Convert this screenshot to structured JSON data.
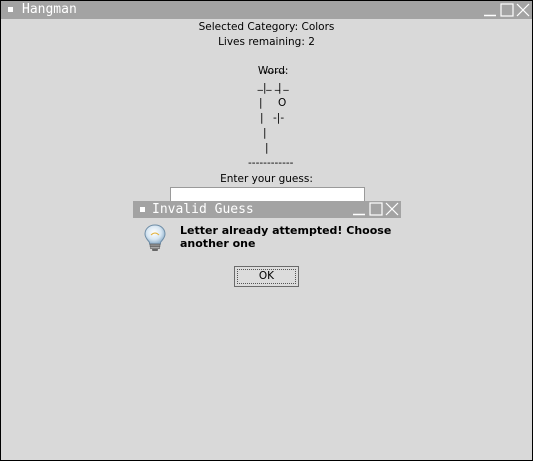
{
  "window": {
    "title": "Hangman",
    "controls": [
      "minimize-icon",
      "maximize-icon",
      "close-icon"
    ]
  },
  "game": {
    "category_text": "Selected Category: Colors",
    "lives_text": "Lives remaining: 2",
    "word_label": "Word:",
    "word_blanks": "_ _ _ _",
    "gallows": {
      "top_bar": "------",
      "row1_left": "|",
      "row1_right": "|",
      "row2_left": "|",
      "row2_right": "O",
      "row3_left": "|",
      "row3_right": "-|-",
      "row4": "|",
      "row5": "|",
      "base": "------------"
    },
    "guess_prompt": "Enter your guess:",
    "guess_value": ""
  },
  "dialog": {
    "title": "Invalid Guess",
    "message": "Letter already attempted! Choose another one",
    "icon": "lightbulb-icon",
    "ok_label": "OK"
  }
}
